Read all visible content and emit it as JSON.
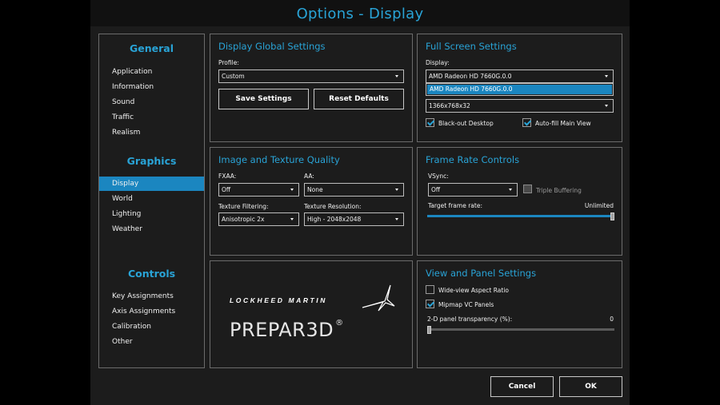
{
  "window": {
    "title": "Options - Display"
  },
  "sidebar": {
    "sections": [
      {
        "heading": "General",
        "items": [
          "Application",
          "Information",
          "Sound",
          "Traffic",
          "Realism"
        ]
      },
      {
        "heading": "Graphics",
        "items": [
          "Display",
          "World",
          "Lighting",
          "Weather"
        ]
      },
      {
        "heading": "Controls",
        "items": [
          "Key Assignments",
          "Axis Assignments",
          "Calibration",
          "Other"
        ]
      }
    ],
    "active_item": "Display"
  },
  "display_global": {
    "title": "Display Global Settings",
    "profile_label": "Profile:",
    "profile_value": "Custom",
    "save_label": "Save Settings",
    "reset_label": "Reset Defaults"
  },
  "fullscreen": {
    "title": "Full Screen Settings",
    "display_label": "Display:",
    "display_value": "AMD Radeon HD 7660G.0.0",
    "display_options": [
      "AMD Radeon HD 7660G.0.0"
    ],
    "resolution_value": "1366x768x32",
    "blackout_label": "Black-out Desktop",
    "blackout_checked": true,
    "autofill_label": "Auto-fill Main View",
    "autofill_checked": true
  },
  "image_quality": {
    "title": "Image and Texture Quality",
    "fxaa_label": "FXAA:",
    "fxaa_value": "Off",
    "aa_label": "AA:",
    "aa_value": "None",
    "filtering_label": "Texture Filtering:",
    "filtering_value": "Anisotropic 2x",
    "resolution_label": "Texture Resolution:",
    "resolution_value": "High - 2048x2048"
  },
  "frame_rate": {
    "title": "Frame Rate Controls",
    "vsync_label": "VSync:",
    "vsync_value": "Off",
    "triple_label": "Triple Buffering",
    "triple_checked": false,
    "target_label": "Target frame rate:",
    "target_value": "Unlimited",
    "target_fraction": 1.0
  },
  "logo": {
    "company": "LOCKHEED MARTIN",
    "product": "PREPAR3D",
    "mark": "®"
  },
  "view_panel": {
    "title": "View and Panel Settings",
    "wide_label": "Wide-view Aspect Ratio",
    "wide_checked": false,
    "mipmap_label": "Mipmap VC Panels",
    "mipmap_checked": true,
    "transparency_label": "2-D panel transparency (%):",
    "transparency_value": "0",
    "transparency_fraction": 0.0
  },
  "footer": {
    "cancel_label": "Cancel",
    "ok_label": "OK"
  },
  "colors": {
    "accent": "#29a3d6",
    "selection": "#1b86c0",
    "panel_bg": "#1c1c1c"
  }
}
